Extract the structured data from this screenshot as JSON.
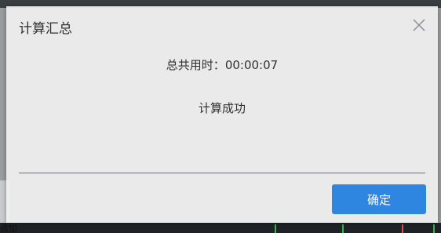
{
  "dialog": {
    "title": "计算汇总",
    "elapsed_label": "总共用时：",
    "elapsed_value": "00:00:07",
    "status_text": "计算成功",
    "confirm_label": "确定",
    "close_icon": "close-icon"
  },
  "background": {
    "partial_text": "点加"
  },
  "colors": {
    "accent": "#2f86e0",
    "dialog_bg": "#f0f0f0",
    "text": "#303133"
  }
}
